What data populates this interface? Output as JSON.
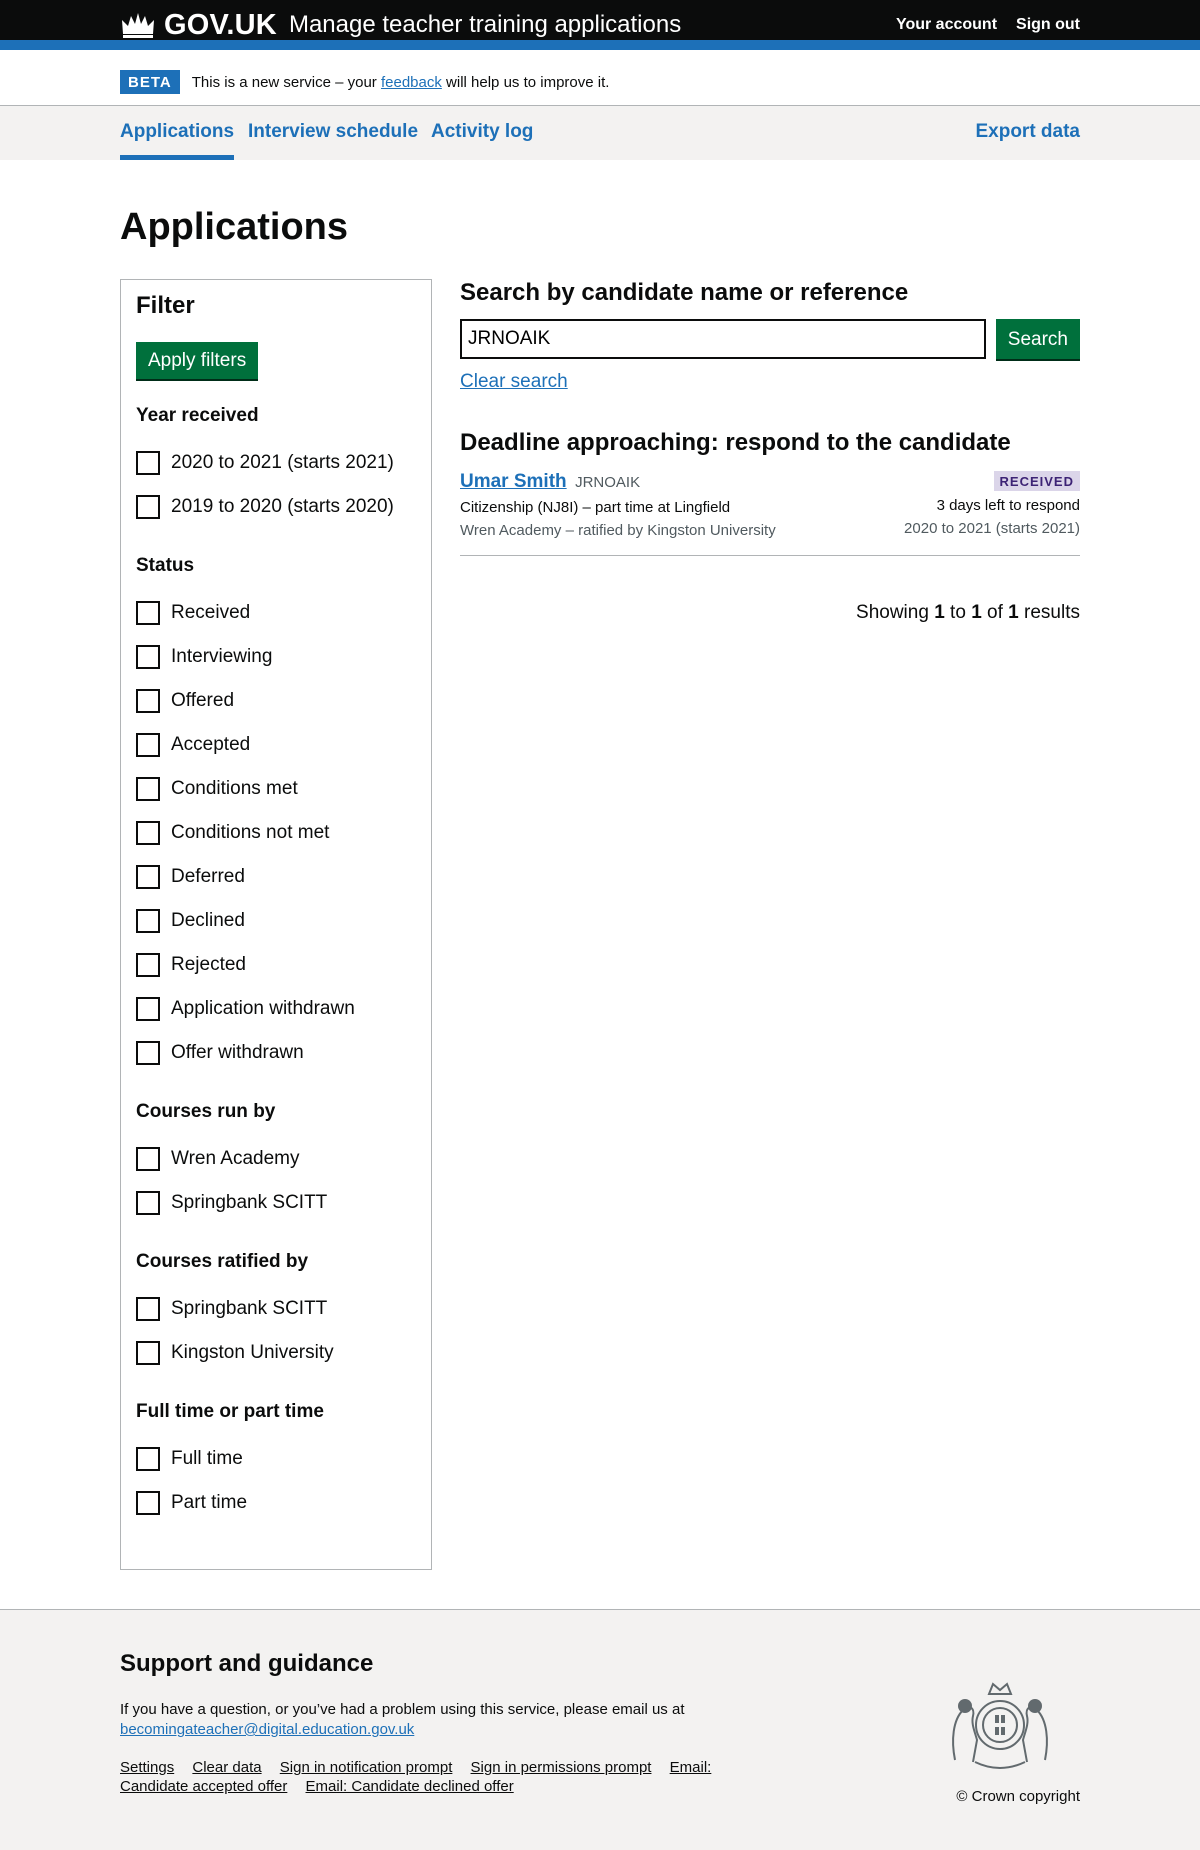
{
  "header": {
    "logo": "GOV.UK",
    "service_name": "Manage teacher training applications",
    "nav": [
      "Your account",
      "Sign out"
    ]
  },
  "phase_banner": {
    "tag": "BETA",
    "text_before": "This is a new service – your ",
    "link": "feedback",
    "text_after": " will help us to improve it."
  },
  "primary_nav": {
    "items": [
      "Applications",
      "Interview schedule",
      "Activity log"
    ],
    "active": "Applications",
    "export": "Export data"
  },
  "page_title": "Applications",
  "filter": {
    "title": "Filter",
    "apply_button": "Apply filters",
    "groups": [
      {
        "title": "Year received",
        "options": [
          "2020 to 2021 (starts 2021)",
          "2019 to 2020 (starts 2020)"
        ]
      },
      {
        "title": "Status",
        "options": [
          "Received",
          "Interviewing",
          "Offered",
          "Accepted",
          "Conditions met",
          "Conditions not met",
          "Deferred",
          "Declined",
          "Rejected",
          "Application withdrawn",
          "Offer withdrawn"
        ]
      },
      {
        "title": "Courses run by",
        "options": [
          "Wren Academy",
          "Springbank SCITT"
        ]
      },
      {
        "title": "Courses ratified by",
        "options": [
          "Springbank SCITT",
          "Kingston University"
        ]
      },
      {
        "title": "Full time or part time",
        "options": [
          "Full time",
          "Part time"
        ]
      }
    ]
  },
  "search": {
    "title": "Search by candidate name or reference",
    "value": "JRNOAIK",
    "button": "Search",
    "clear": "Clear search"
  },
  "deadline_heading": "Deadline approaching: respond to the candidate",
  "application": {
    "name": "Umar Smith",
    "reference": "JRNOAIK",
    "course": "Citizenship (NJ8I) – part time at Lingfield",
    "provider": "Wren Academy – ratified by Kingston University",
    "status": "RECEIVED",
    "days_left": "3 days left to respond",
    "cycle": "2020 to 2021 (starts 2021)"
  },
  "results": {
    "prefix": "Showing ",
    "from": "1",
    "to_word": " to ",
    "to": "1",
    "of_word": " of ",
    "total": "1",
    "suffix": " results"
  },
  "footer": {
    "title": "Support and guidance",
    "help_text": "If you have a question, or you’ve had a problem using this service, please email us at",
    "email": "becomingateacher@digital.education.gov.uk",
    "links": [
      "Settings",
      "Clear data",
      "Sign in notification prompt",
      "Sign in permissions prompt",
      "Email: Candidate accepted offer",
      "Email: Candidate declined offer"
    ],
    "copyright": "© Crown copyright"
  },
  "colors": {
    "header_bg": "#0b0c0c",
    "brand_blue": "#1d70b8",
    "button_green": "#00703c",
    "tag_purple_bg": "#dbd5e9",
    "tag_purple_text": "#3d2375",
    "footer_bg": "#f3f2f1"
  },
  "icons": [
    "crown-icon",
    "royal-coat-of-arms-icon"
  ]
}
